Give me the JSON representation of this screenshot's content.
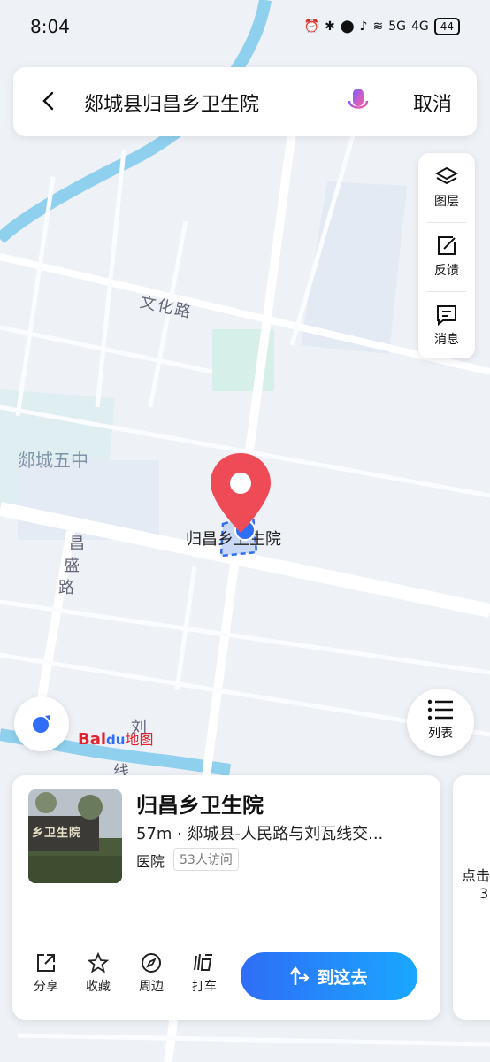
{
  "status_bar": {
    "time": "8:04",
    "signal_a": "5G",
    "signal_b": "4G",
    "battery": "44"
  },
  "search": {
    "query": "郯城县归昌乡卫生院",
    "cancel_label": "取消"
  },
  "map_tools": [
    {
      "label": "图层",
      "icon": "layers-icon"
    },
    {
      "label": "反馈",
      "icon": "feedback-icon"
    },
    {
      "label": "消息",
      "icon": "message-icon"
    }
  ],
  "map_labels": {
    "road_wenhua": "文化路",
    "school": "郯城五中",
    "road_changsheng_1": "昌",
    "road_changsheng_2": "盛",
    "road_changsheng_3": "路",
    "poi_label": "归昌乡卫生院",
    "road_liu_1": "刘",
    "road_liu_2": "线"
  },
  "list_button": {
    "label": "列表"
  },
  "brand": {
    "text_a": "Bai",
    "text_b": "du",
    "text_c": "地图"
  },
  "place_card": {
    "thumb_text": "乡卫生院",
    "name": "归昌乡卫生院",
    "address": "57m · 郯城县-人民路与刘瓦线交...",
    "category": "医院",
    "visits": "53人访问",
    "actions": [
      {
        "label": "分享",
        "icon": "share-icon"
      },
      {
        "label": "收藏",
        "icon": "star-icon"
      },
      {
        "label": "周边",
        "icon": "compass-icon"
      },
      {
        "label": "打车",
        "icon": "taxi-icon"
      }
    ],
    "go_label": "到这去"
  },
  "next_card": {
    "line1": "点击",
    "line2": "3"
  },
  "colors": {
    "accent": "#2f6df6",
    "pin": "#ef4b57",
    "water": "#8fd0ee",
    "green_area": "#d7efe9"
  }
}
